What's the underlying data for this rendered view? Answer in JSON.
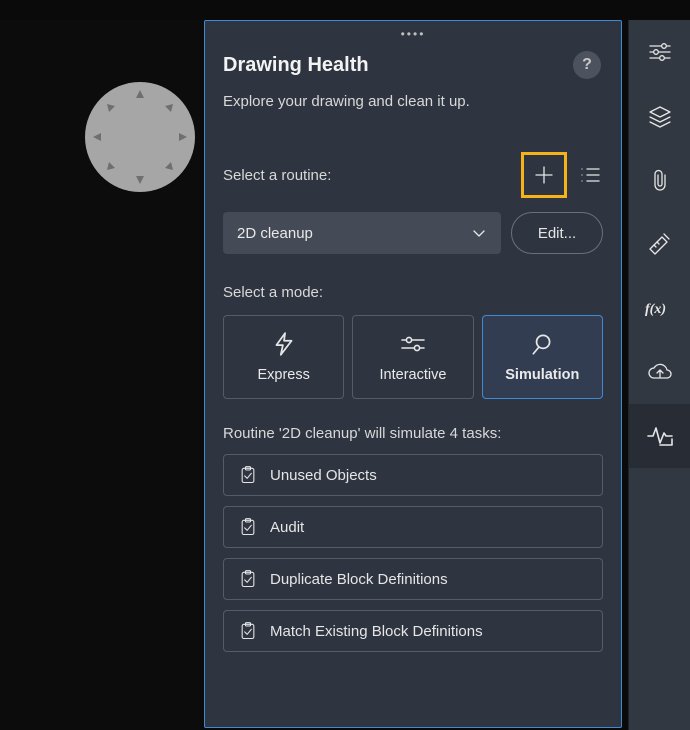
{
  "panel": {
    "title": "Drawing Health",
    "subtitle": "Explore your drawing and clean it up.",
    "help_tooltip": "?",
    "select_routine_label": "Select a routine:",
    "dropdown_value": "2D cleanup",
    "edit_label": "Edit...",
    "select_mode_label": "Select a mode:",
    "modes": [
      {
        "label": "Express",
        "selected": false
      },
      {
        "label": "Interactive",
        "selected": false
      },
      {
        "label": "Simulation",
        "selected": true
      }
    ],
    "status_line": "Routine '2D cleanup' will simulate 4 tasks:",
    "tasks": [
      {
        "label": "Unused Objects"
      },
      {
        "label": "Audit"
      },
      {
        "label": "Duplicate Block Definitions"
      },
      {
        "label": "Match Existing Block Definitions"
      }
    ]
  },
  "right_rail": {
    "items": [
      "settings-sliders",
      "layers",
      "attachment",
      "materials",
      "function-fx",
      "cloud-upload",
      "health-monitor"
    ],
    "active_index": 6
  }
}
